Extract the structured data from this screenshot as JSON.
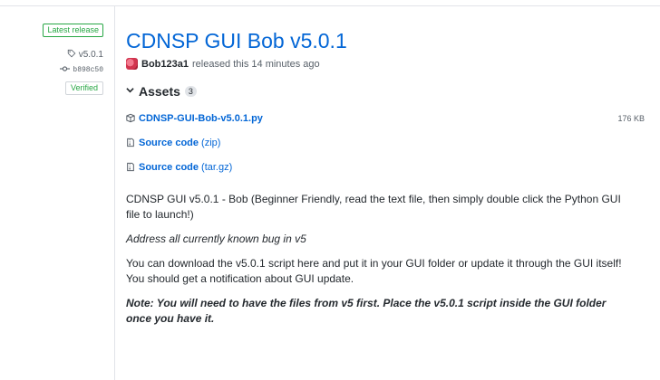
{
  "sidebar": {
    "latest_release_badge": "Latest release",
    "tag": "v5.0.1",
    "commit": "b898c50",
    "verified_badge": "Verified"
  },
  "release": {
    "title": "CDNSP GUI Bob v5.0.1",
    "author": "Bob123a1",
    "released_text": "released this 14 minutes ago"
  },
  "assets": {
    "label": "Assets",
    "count": "3",
    "items": [
      {
        "name": "CDNSP-GUI-Bob-v5.0.1.py",
        "suffix": "",
        "size": "176 KB",
        "icon": "package-icon"
      },
      {
        "name": "Source code",
        "suffix": "(zip)",
        "size": "",
        "icon": "file-zip-icon"
      },
      {
        "name": "Source code",
        "suffix": "(tar.gz)",
        "size": "",
        "icon": "file-zip-icon"
      }
    ]
  },
  "description": {
    "p1": "CDNSP GUI v5.0.1 - Bob (Beginner Friendly, read the text file, then simply double click the Python GUI file to launch!)",
    "p2": "Address all currently known bug in v5",
    "p3": "You can download the v5.0.1 script here and put it in your GUI folder or update it through the GUI itself! You should get a notification about GUI update.",
    "p4": "Note: You will need to have the files from v5 first. Place the v5.0.1 script inside the GUI folder once you have it."
  },
  "colors": {
    "link": "#0366d6",
    "green": "#28a745",
    "muted": "#586069",
    "text": "#24292e"
  }
}
